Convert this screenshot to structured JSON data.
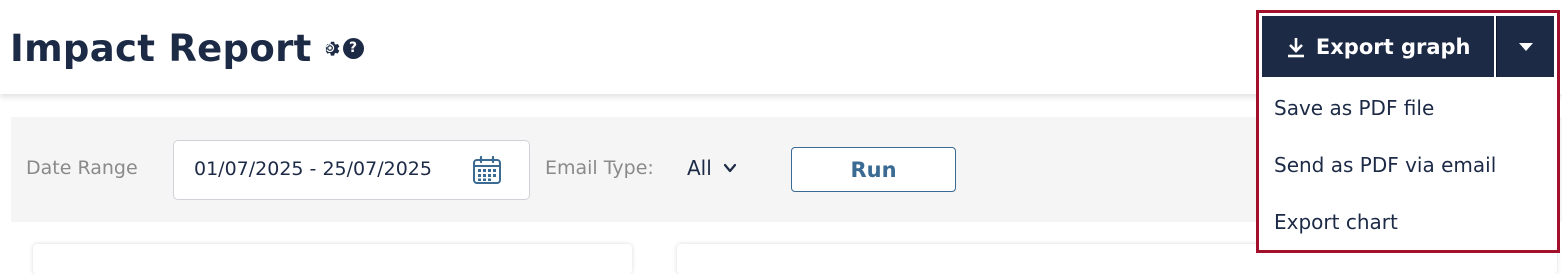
{
  "header": {
    "title": "Impact Report",
    "icons": [
      "gear-icon",
      "help-icon"
    ],
    "help_glyph": "?"
  },
  "filters": {
    "date_range_label": "Date Range",
    "date_range_value": "01/07/2025 - 25/07/2025",
    "email_type_label": "Email Type:",
    "email_type_value": "All",
    "run_label": "Run"
  },
  "export": {
    "button_label": "Export graph",
    "menu_items": [
      {
        "label": "Save as PDF file"
      },
      {
        "label": "Send as PDF via email"
      },
      {
        "label": "Export chart"
      }
    ]
  },
  "colors": {
    "brand_navy": "#1c2a46",
    "accent_blue": "#3b6a93",
    "highlight_red": "#a3102c",
    "filter_bg": "#f5f5f5"
  }
}
